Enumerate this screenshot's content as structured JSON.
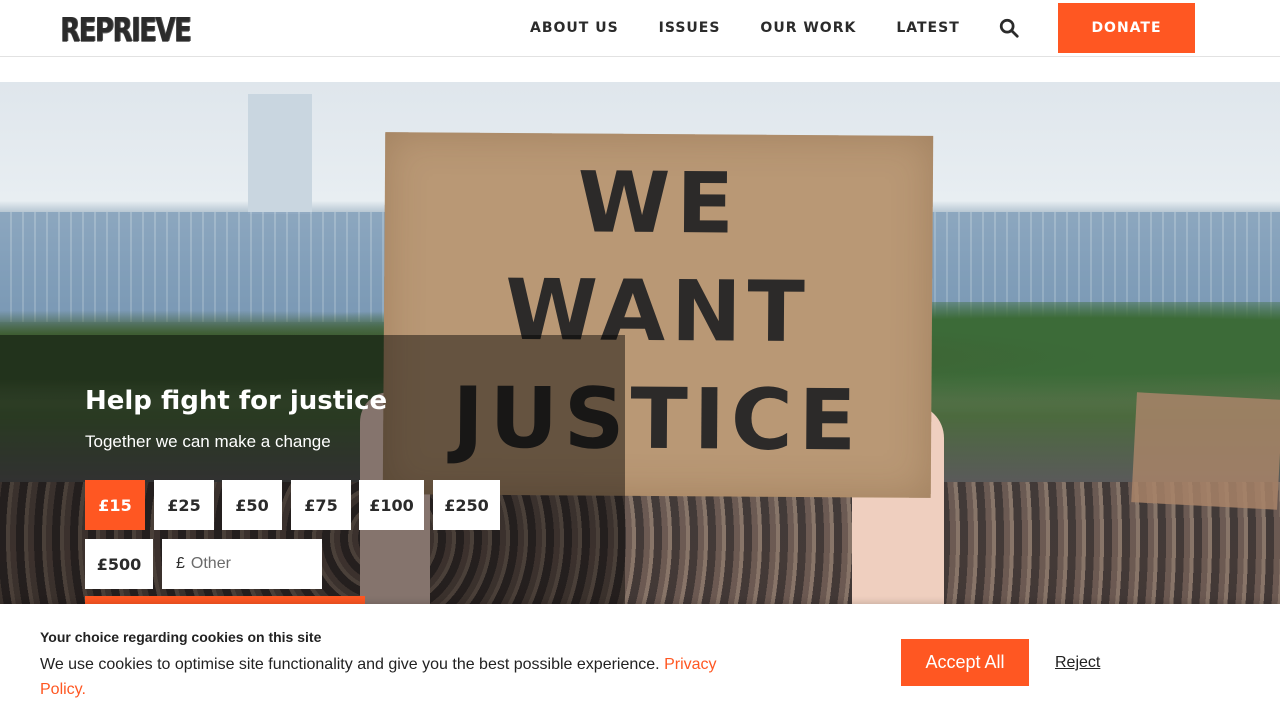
{
  "header": {
    "logo": "REPRIEVE",
    "nav": [
      "ABOUT US",
      "ISSUES",
      "OUR WORK",
      "LATEST"
    ],
    "donate_label": "DONATE"
  },
  "hero": {
    "sign_lines": [
      "WE",
      "WANT",
      "JUSTICE"
    ]
  },
  "donation_form": {
    "title": "Help fight for justice",
    "subtitle": "Together we can make a change",
    "amounts": [
      "£15",
      "£25",
      "£50",
      "£75",
      "£100",
      "£250",
      "£500"
    ],
    "selected_amount": "£15",
    "other_currency": "£",
    "other_placeholder": "Other"
  },
  "cookie_banner": {
    "title": "Your choice regarding cookies on this site",
    "text": "We use cookies to optimise site functionality and give you the best possible experience.",
    "privacy_link": "Privacy Policy.",
    "accept_label": "Accept All",
    "reject_label": "Reject"
  },
  "colors": {
    "accent": "#ff5722",
    "text": "#2b2b2b"
  }
}
